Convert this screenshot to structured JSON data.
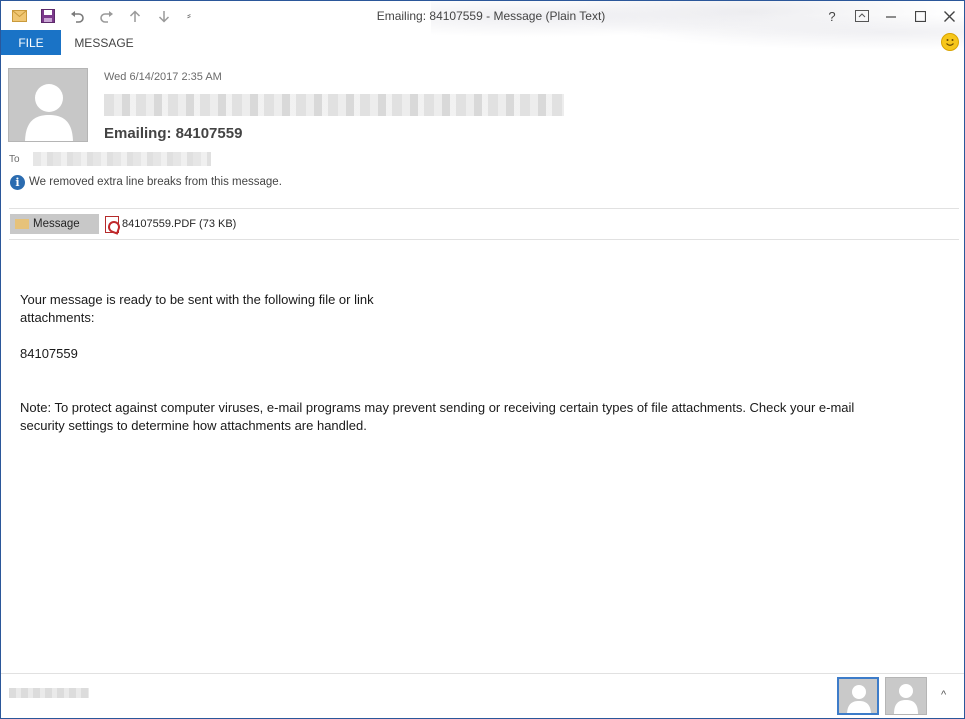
{
  "window": {
    "title": "Emailing: 84107559 - Message (Plain Text)"
  },
  "quick_access": {
    "icons": [
      "mail-icon",
      "save-icon",
      "undo-icon",
      "redo-icon",
      "up-arrow-icon",
      "down-arrow-icon",
      "customize-icon"
    ],
    "customize_glyph": "⸗"
  },
  "window_controls": {
    "help": "?",
    "ribbon_display": "⊡",
    "minimize": "—",
    "maximize": "☐",
    "close": "✕"
  },
  "ribbon": {
    "tabs": [
      {
        "label": "FILE",
        "active_color": "#1a73c6"
      },
      {
        "label": "MESSAGE"
      }
    ]
  },
  "header": {
    "date": "Wed 6/14/2017 2:35 AM",
    "subject": "Emailing: 84107559",
    "to_label": "To",
    "info_glyph": "i",
    "info_text": "We removed extra line breaks from this message."
  },
  "attachments": {
    "message_tab": "Message",
    "file": "84107559.PDF (73 KB)"
  },
  "body": {
    "line1": "Your message is ready to be sent with the following file or link",
    "line2": "attachments:",
    "line3": "84107559",
    "line4": "Note: To protect against computer viruses, e-mail programs may prevent sending or receiving certain types of file attachments.  Check your e-mail",
    "line5": "security settings to determine how attachments are handled."
  },
  "footer": {
    "expand_glyph": "^"
  },
  "colors": {
    "accent": "#1a73c6",
    "frame": "#2b579a"
  }
}
